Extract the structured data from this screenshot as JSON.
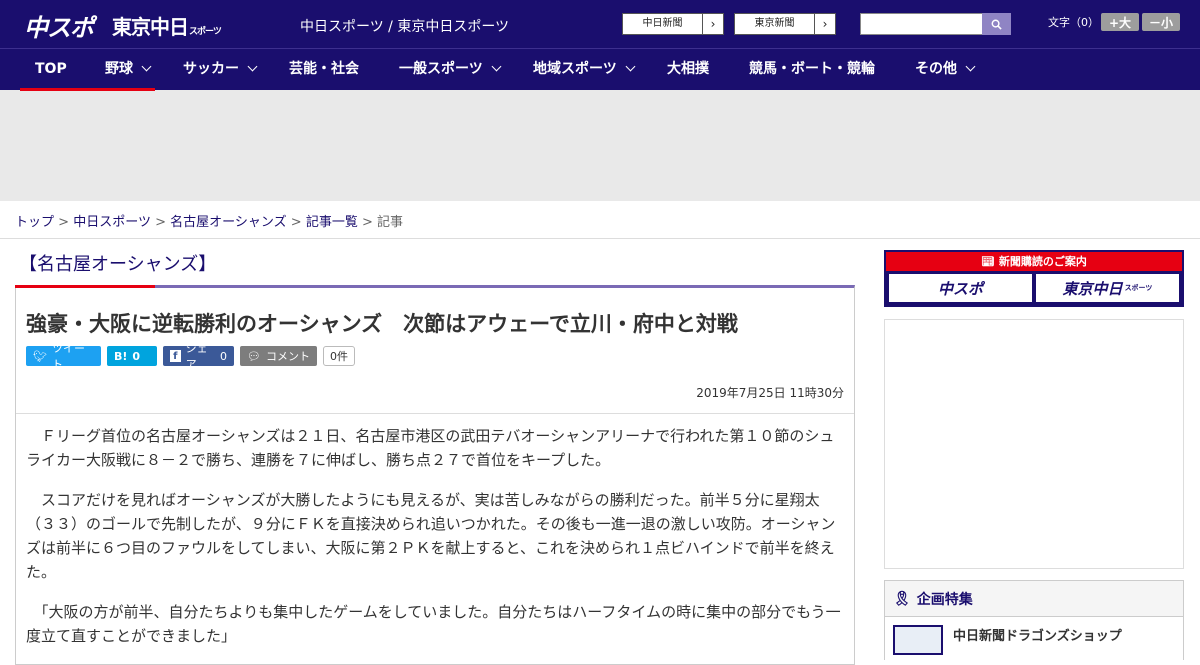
{
  "header": {
    "logo_chuspo": "中スポ",
    "logo_tokyo": "東京中日",
    "logo_tokyo_suffix": "スポーツ",
    "site_title": "中日スポーツ / 東京中日スポーツ",
    "paper_links": [
      {
        "label": "中日新聞"
      },
      {
        "label": "東京新聞"
      }
    ],
    "search": {
      "placeholder": ""
    },
    "font_size": {
      "label": "文字（0）",
      "larger": "+大",
      "smaller": "－小"
    }
  },
  "nav": {
    "items": [
      {
        "label": "TOP",
        "dropdown": false
      },
      {
        "label": "野球",
        "dropdown": true
      },
      {
        "label": "サッカー",
        "dropdown": true
      },
      {
        "label": "芸能・社会",
        "dropdown": false
      },
      {
        "label": "一般スポーツ",
        "dropdown": true
      },
      {
        "label": "地域スポーツ",
        "dropdown": true
      },
      {
        "label": "大相撲",
        "dropdown": false
      },
      {
        "label": "競馬・ボート・競輪",
        "dropdown": false
      },
      {
        "label": "その他",
        "dropdown": true
      }
    ]
  },
  "breadcrumb": {
    "items": [
      "トップ",
      "中日スポーツ",
      "名古屋オーシャンズ",
      "記事一覧"
    ],
    "current": "記事",
    "separator": ">"
  },
  "article": {
    "section": "【名古屋オーシャンズ】",
    "headline": "強豪・大阪に逆転勝利のオーシャンズ　次節はアウェーで立川・府中と対戦",
    "share": {
      "tweet": "ツイート",
      "hatena_label": "B!",
      "hatena_count": "0",
      "facebook": "シェア",
      "facebook_count": "0",
      "comment": "コメント",
      "comment_count": "0件"
    },
    "date": "2019年7月25日 11時30分",
    "paragraphs": [
      "　Ｆリーグ首位の名古屋オーシャンズは２１日、名古屋市港区の武田テバオーシャンアリーナで行われた第１０節のシュライカー大阪戦に８－２で勝ち、連勝を７に伸ばし、勝ち点２７で首位をキープした。",
      "　スコアだけを見ればオーシャンズが大勝したようにも見えるが、実は苦しみながらの勝利だった。前半５分に星翔太（３３）のゴールで先制したが、９分にＦＫを直接決められ追いつかれた。その後も一進一退の激しい攻防。オーシャンズは前半に６つ目のファウルをしてしまい、大阪に第２ＰＫを献上すると、これを決められ１点ビハインドで前半を終えた。",
      "　「大阪の方が前半、自分たちよりも集中したゲームをしていました。自分たちはハーフタイムの時に集中の部分でもう一度立て直すことができました」"
    ]
  },
  "sidebar": {
    "subscribe_heading": "新聞購読のご案内",
    "subscribe_logo_1": "中スポ",
    "subscribe_logo_2": "東京中日",
    "subscribe_logo_2_suffix": "スポーツ",
    "kikaku_heading": "企画特集",
    "kikaku_item": "中日新聞ドラゴンズショップ"
  },
  "colors": {
    "brand_navy": "#1a0e6e",
    "accent_red": "#e60012",
    "accent_purple": "#7a6ab5"
  }
}
